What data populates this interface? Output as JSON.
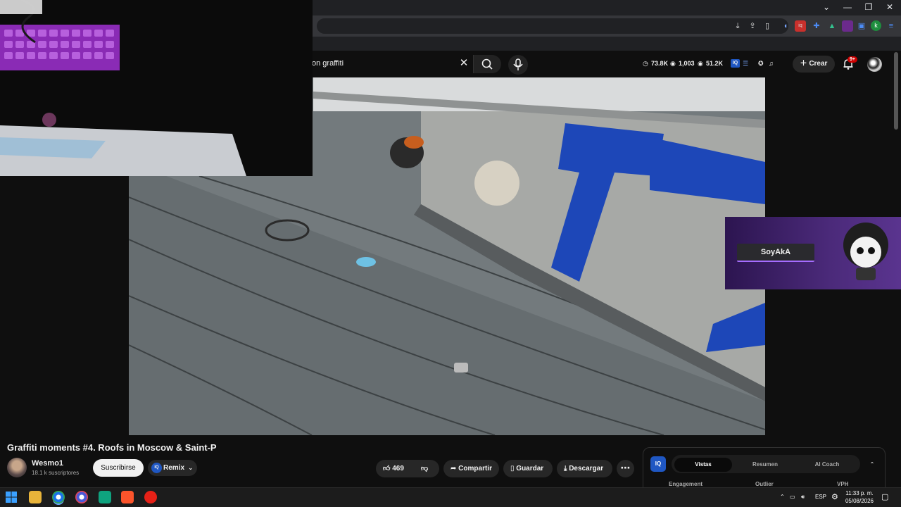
{
  "browser": {
    "window_controls": [
      "⌄",
      "—",
      "❐",
      "✕"
    ],
    "profile_initial": "k",
    "extensions": [
      "download-icon",
      "share-icon",
      "bookmark-icon",
      "sound-icon",
      "vidiq-icon",
      "puzzle-icon",
      "flask-icon",
      "pink-ext-icon",
      "sidebar-icon",
      "menu-icon"
    ]
  },
  "header": {
    "search_value": "on graffiti",
    "create_label": "Crear",
    "notifications_badge": "9+",
    "stats": {
      "views": "73.8K",
      "watching": "1,003",
      "views_alt": "51.2K"
    }
  },
  "video": {
    "webcam_visible": true,
    "overlay_name": "SoyAkA"
  },
  "meta": {
    "title": "Graffiti moments #4. Roofs in Moscow & Saint-P",
    "channel_name": "Wesmo1",
    "subscribers": "18.1 k suscriptores",
    "subscribe_label": "Suscribirse",
    "remix_label": "Remix",
    "remix_badge": "IQ",
    "like_count": "469",
    "share_label": "Compartir",
    "save_label": "Guardar",
    "download_label": "Descargar"
  },
  "iq_panel": {
    "logo": "IQ",
    "tabs": [
      "Vistas",
      "Resumen",
      "AI Coach"
    ],
    "active_tab": "Vistas",
    "columns": [
      "Engagement",
      "Outlier",
      "VPH"
    ]
  },
  "taskbar": {
    "language": "ESP",
    "time": "11:33 p. m.",
    "date": "05/08/2026"
  },
  "colors": {
    "background": "#0f0f0f",
    "pill": "#272727",
    "accent_blue": "#1f57c3",
    "overlay_purple": "#4b2a7a",
    "notification_red": "#cc0000"
  }
}
